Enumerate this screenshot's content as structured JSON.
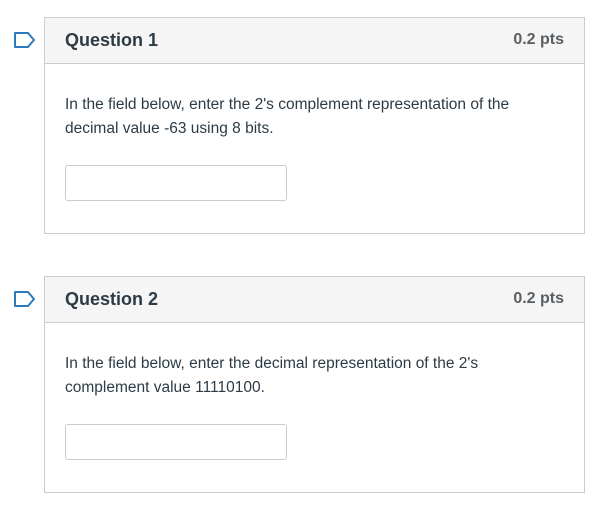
{
  "questions": [
    {
      "title": "Question 1",
      "points": "0.2 pts",
      "text": "In the field below, enter the 2's complement representation of the decimal value -63 using 8 bits.",
      "answer_value": "",
      "flag_icon": "bookmark-flag-icon"
    },
    {
      "title": "Question 2",
      "points": "0.2 pts",
      "text": "In the field below, enter the decimal representation of the 2's complement value 11110100.",
      "answer_value": "",
      "flag_icon": "bookmark-flag-icon"
    }
  ],
  "colors": {
    "flag": "#2b7abc",
    "border": "#c7cdd1",
    "header_bg": "#f5f5f5",
    "text": "#2d3b45"
  }
}
